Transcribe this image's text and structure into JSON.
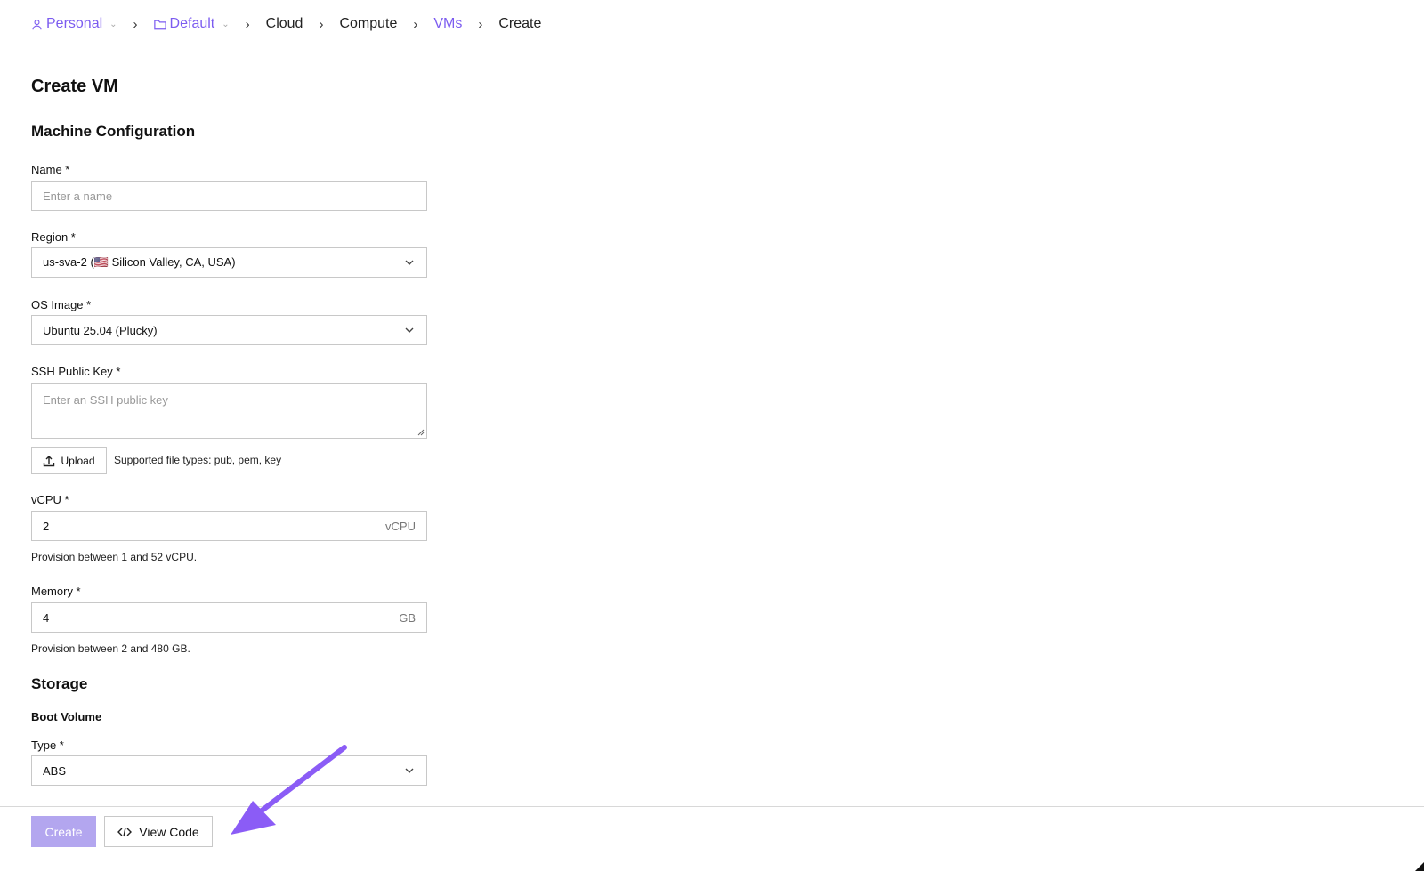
{
  "breadcrumb": {
    "personal": "Personal",
    "default": "Default",
    "cloud": "Cloud",
    "compute": "Compute",
    "vms": "VMs",
    "create": "Create"
  },
  "page": {
    "title": "Create VM"
  },
  "machine": {
    "title": "Machine Configuration",
    "name_label": "Name *",
    "name_placeholder": "Enter a name",
    "region_label": "Region *",
    "region_value": "us-sva-2 (🇺🇸 Silicon Valley, CA, USA)",
    "os_label": "OS Image *",
    "os_value": "Ubuntu 25.04 (Plucky)",
    "ssh_label": "SSH Public Key *",
    "ssh_placeholder": "Enter an SSH public key",
    "upload_label": "Upload",
    "upload_hint": "Supported file types: pub, pem, key",
    "vcpu_label": "vCPU *",
    "vcpu_value": "2",
    "vcpu_unit": "vCPU",
    "vcpu_hint": "Provision between 1 and 52 vCPU.",
    "memory_label": "Memory *",
    "memory_value": "4",
    "memory_unit": "GB",
    "memory_hint": "Provision between 2 and 480 GB."
  },
  "storage": {
    "title": "Storage",
    "boot_title": "Boot Volume",
    "type_label": "Type *",
    "type_value": "ABS"
  },
  "footer": {
    "create_label": "Create",
    "view_code_label": "View Code"
  },
  "colors": {
    "accent": "#7c5cf0",
    "create_disabled": "#b3a6ef",
    "arrow": "#8b5cf6"
  }
}
